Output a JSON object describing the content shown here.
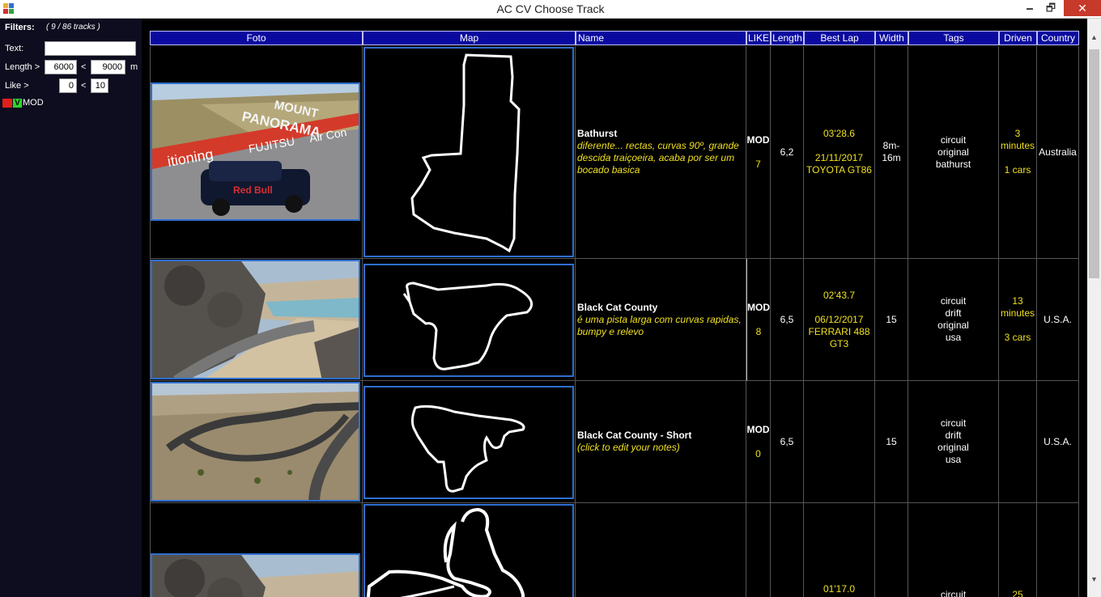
{
  "window": {
    "title": "AC CV Choose Track",
    "min": "🗕",
    "max": "🗗",
    "close": "✕"
  },
  "filters": {
    "title": "Filters:",
    "count": "( 9 / 86 tracks )",
    "text_label": "Text:",
    "text_value": "",
    "length_label": "Length >",
    "length_min": "6000",
    "length_lt": "<",
    "length_max": "9000",
    "length_unit": "m",
    "like_label": "Like >",
    "like_min": "0",
    "like_lt": "<",
    "like_max": "10",
    "mod_check": "V",
    "mod_label": "MOD"
  },
  "columns": [
    "Foto",
    "Map",
    "Name",
    "LIKE",
    "Length",
    "Best Lap",
    "Width",
    "Tags",
    "Driven",
    "Country"
  ],
  "rows": [
    {
      "name": "Bathurst",
      "note": "diferente... rectas, curvas 90º, grande descida traiçoeira, acaba por ser um bocado basica",
      "like_mod": "MOD",
      "like_val": "7",
      "length": "6,2",
      "bestlap_time": "03'28.6",
      "bestlap_date": "21/11/2017",
      "bestlap_car": "TOYOTA GT86",
      "width": "8m-16m",
      "tags": [
        "circuit",
        "original",
        "bathurst"
      ],
      "driven_time": "3 minutes",
      "driven_cars": "1 cars",
      "country": "Australia"
    },
    {
      "name": "Black Cat County",
      "note": "é uma pista larga com curvas rapidas, bumpy e relevo",
      "like_mod": "MOD",
      "like_val": "8",
      "length": "6,5",
      "bestlap_time": "02'43.7",
      "bestlap_date": "06/12/2017",
      "bestlap_car": "FERRARI 488 GT3",
      "width": "15",
      "tags": [
        "circuit",
        "drift",
        "original",
        "usa"
      ],
      "driven_time": "13 minutes",
      "driven_cars": "3 cars",
      "country": "U.S.A."
    },
    {
      "name": "Black Cat County - Short",
      "note": "(click to edit your notes)",
      "like_mod": "MOD",
      "like_val": "0",
      "length": "6,5",
      "bestlap_time": "",
      "bestlap_date": "",
      "bestlap_car": "",
      "width": "15",
      "tags": [
        "circuit",
        "drift",
        "original",
        "usa"
      ],
      "driven_time": "",
      "driven_cars": "",
      "country": "U.S.A."
    },
    {
      "bestlap_time": "01'17.0",
      "tag_first": "circuit",
      "driven_time": "25"
    }
  ]
}
